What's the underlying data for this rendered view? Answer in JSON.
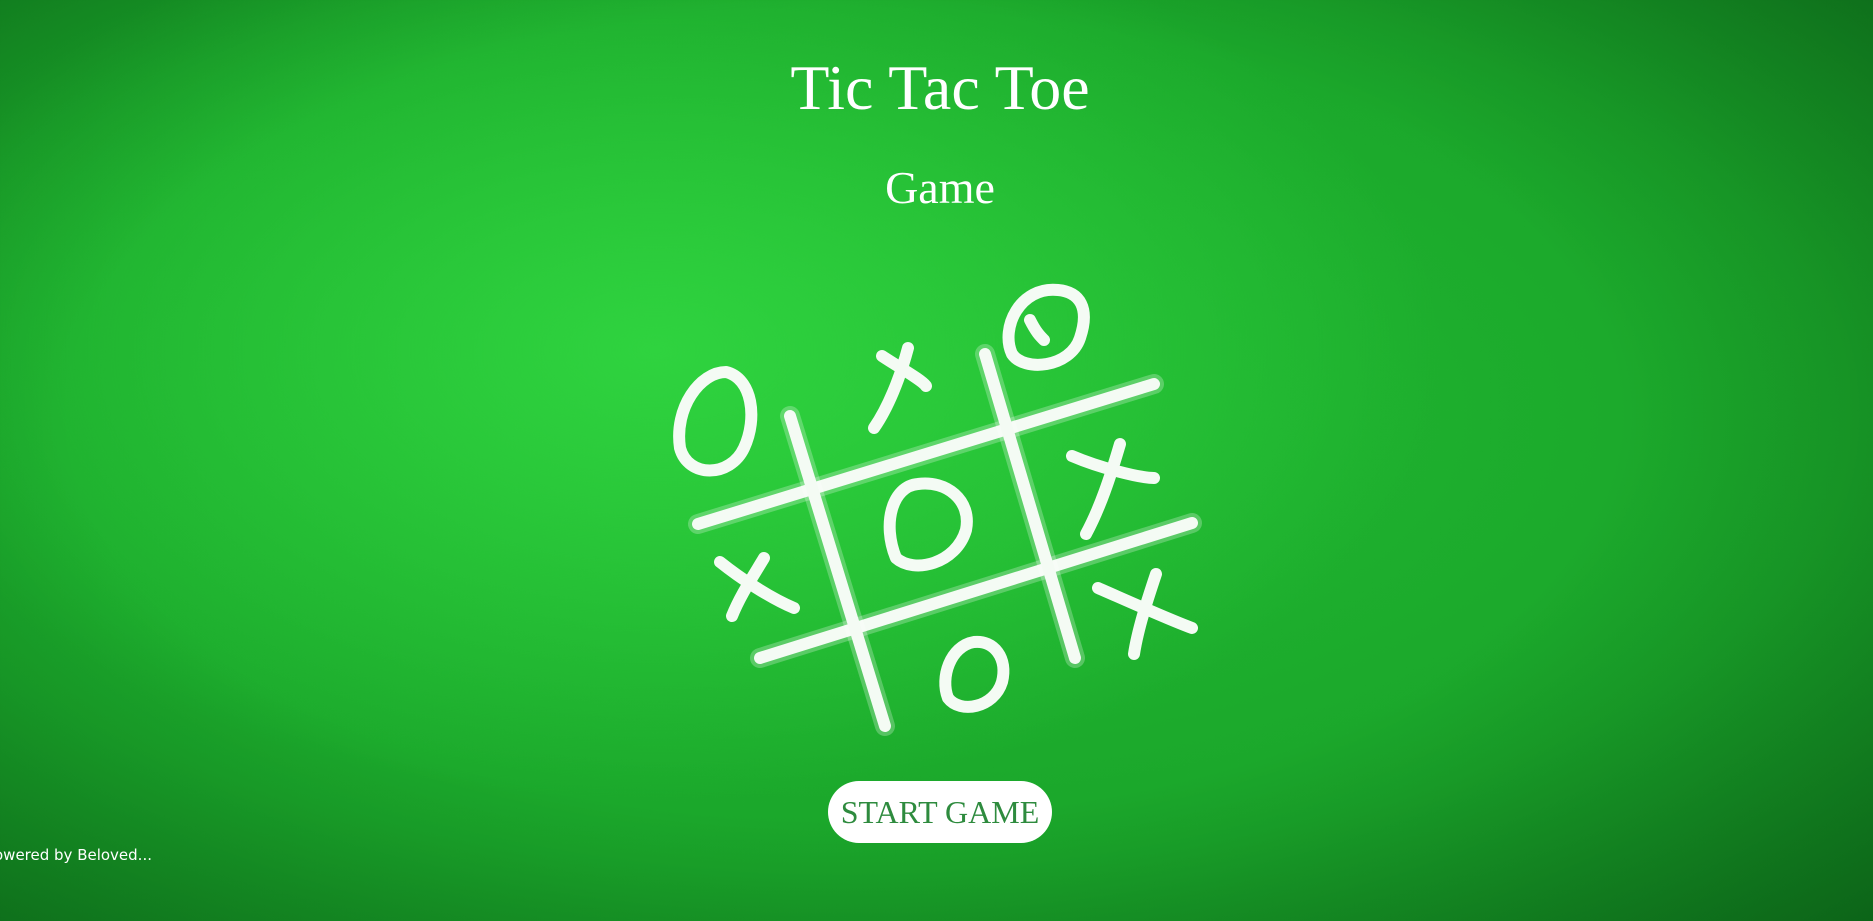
{
  "game": {
    "title": "Tic Tac Toe",
    "subtitle": "Game",
    "start_button_label": "START GAME",
    "footer_text": "owered by Beloved...",
    "colors": {
      "background": "#22bb32",
      "text": "#ffffff",
      "button_background": "#ffffff",
      "button_text": "#2e8b3e"
    }
  }
}
